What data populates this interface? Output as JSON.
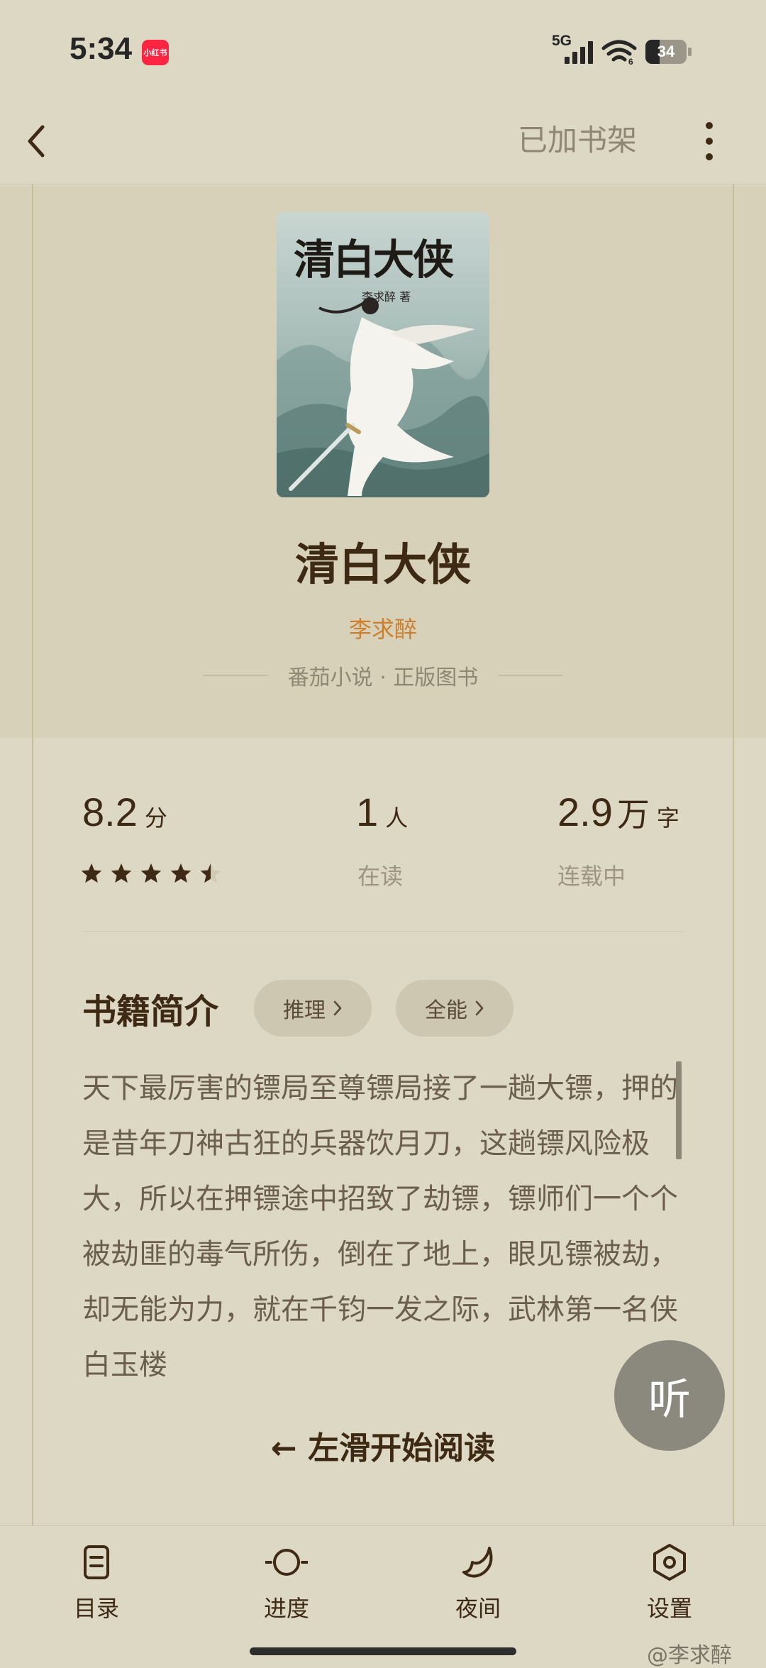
{
  "status_bar": {
    "time": "5:34",
    "app_badge": "小红书",
    "network": "5G",
    "battery_level": 34,
    "battery_text": "34"
  },
  "nav": {
    "shelf_label": "已加书架",
    "back_icon": "chevron-left-icon",
    "more_icon": "vertical-dots-icon"
  },
  "book": {
    "cover_title": "清白大侠",
    "cover_author": "李求醉 著",
    "title": "清白大侠",
    "author": "李求醉",
    "source": "番茄小说 · 正版图书"
  },
  "stats": {
    "score": "8.2",
    "score_unit": "分",
    "rating_stars": 4.5,
    "readers": "1",
    "readers_unit": "人",
    "readers_label": "在读",
    "words": "2.9",
    "words_unit": "万",
    "words_unit2": "字",
    "status_label": "连载中"
  },
  "intro": {
    "heading": "书籍简介",
    "tags": [
      "推理",
      "全能"
    ],
    "text": "天下最厉害的镖局至尊镖局接了一趟大镖，押的是昔年刀神古狂的兵器饮月刀，这趟镖风险极大，所以在押镖途中招致了劫镖，镖师们一个个被劫匪的毒气所伤，倒在了地上，眼见镖被劫，却无能为力，就在千钧一发之际，武林第一名侠白玉楼"
  },
  "swipe_hint": "← 左滑开始阅读",
  "listen_label": "听",
  "bottom_tabs": [
    {
      "label": "目录",
      "icon": "table-of-contents-icon"
    },
    {
      "label": "进度",
      "icon": "progress-icon"
    },
    {
      "label": "夜间",
      "icon": "moon-icon"
    },
    {
      "label": "设置",
      "icon": "settings-icon"
    }
  ],
  "watermark": "@李求醉",
  "colors": {
    "background": "#ddd8c3",
    "hero_background": "#d7d1ba",
    "text_primary": "#3e2a14",
    "author_accent": "#cc7f2e",
    "text_muted": "#8f8774"
  }
}
